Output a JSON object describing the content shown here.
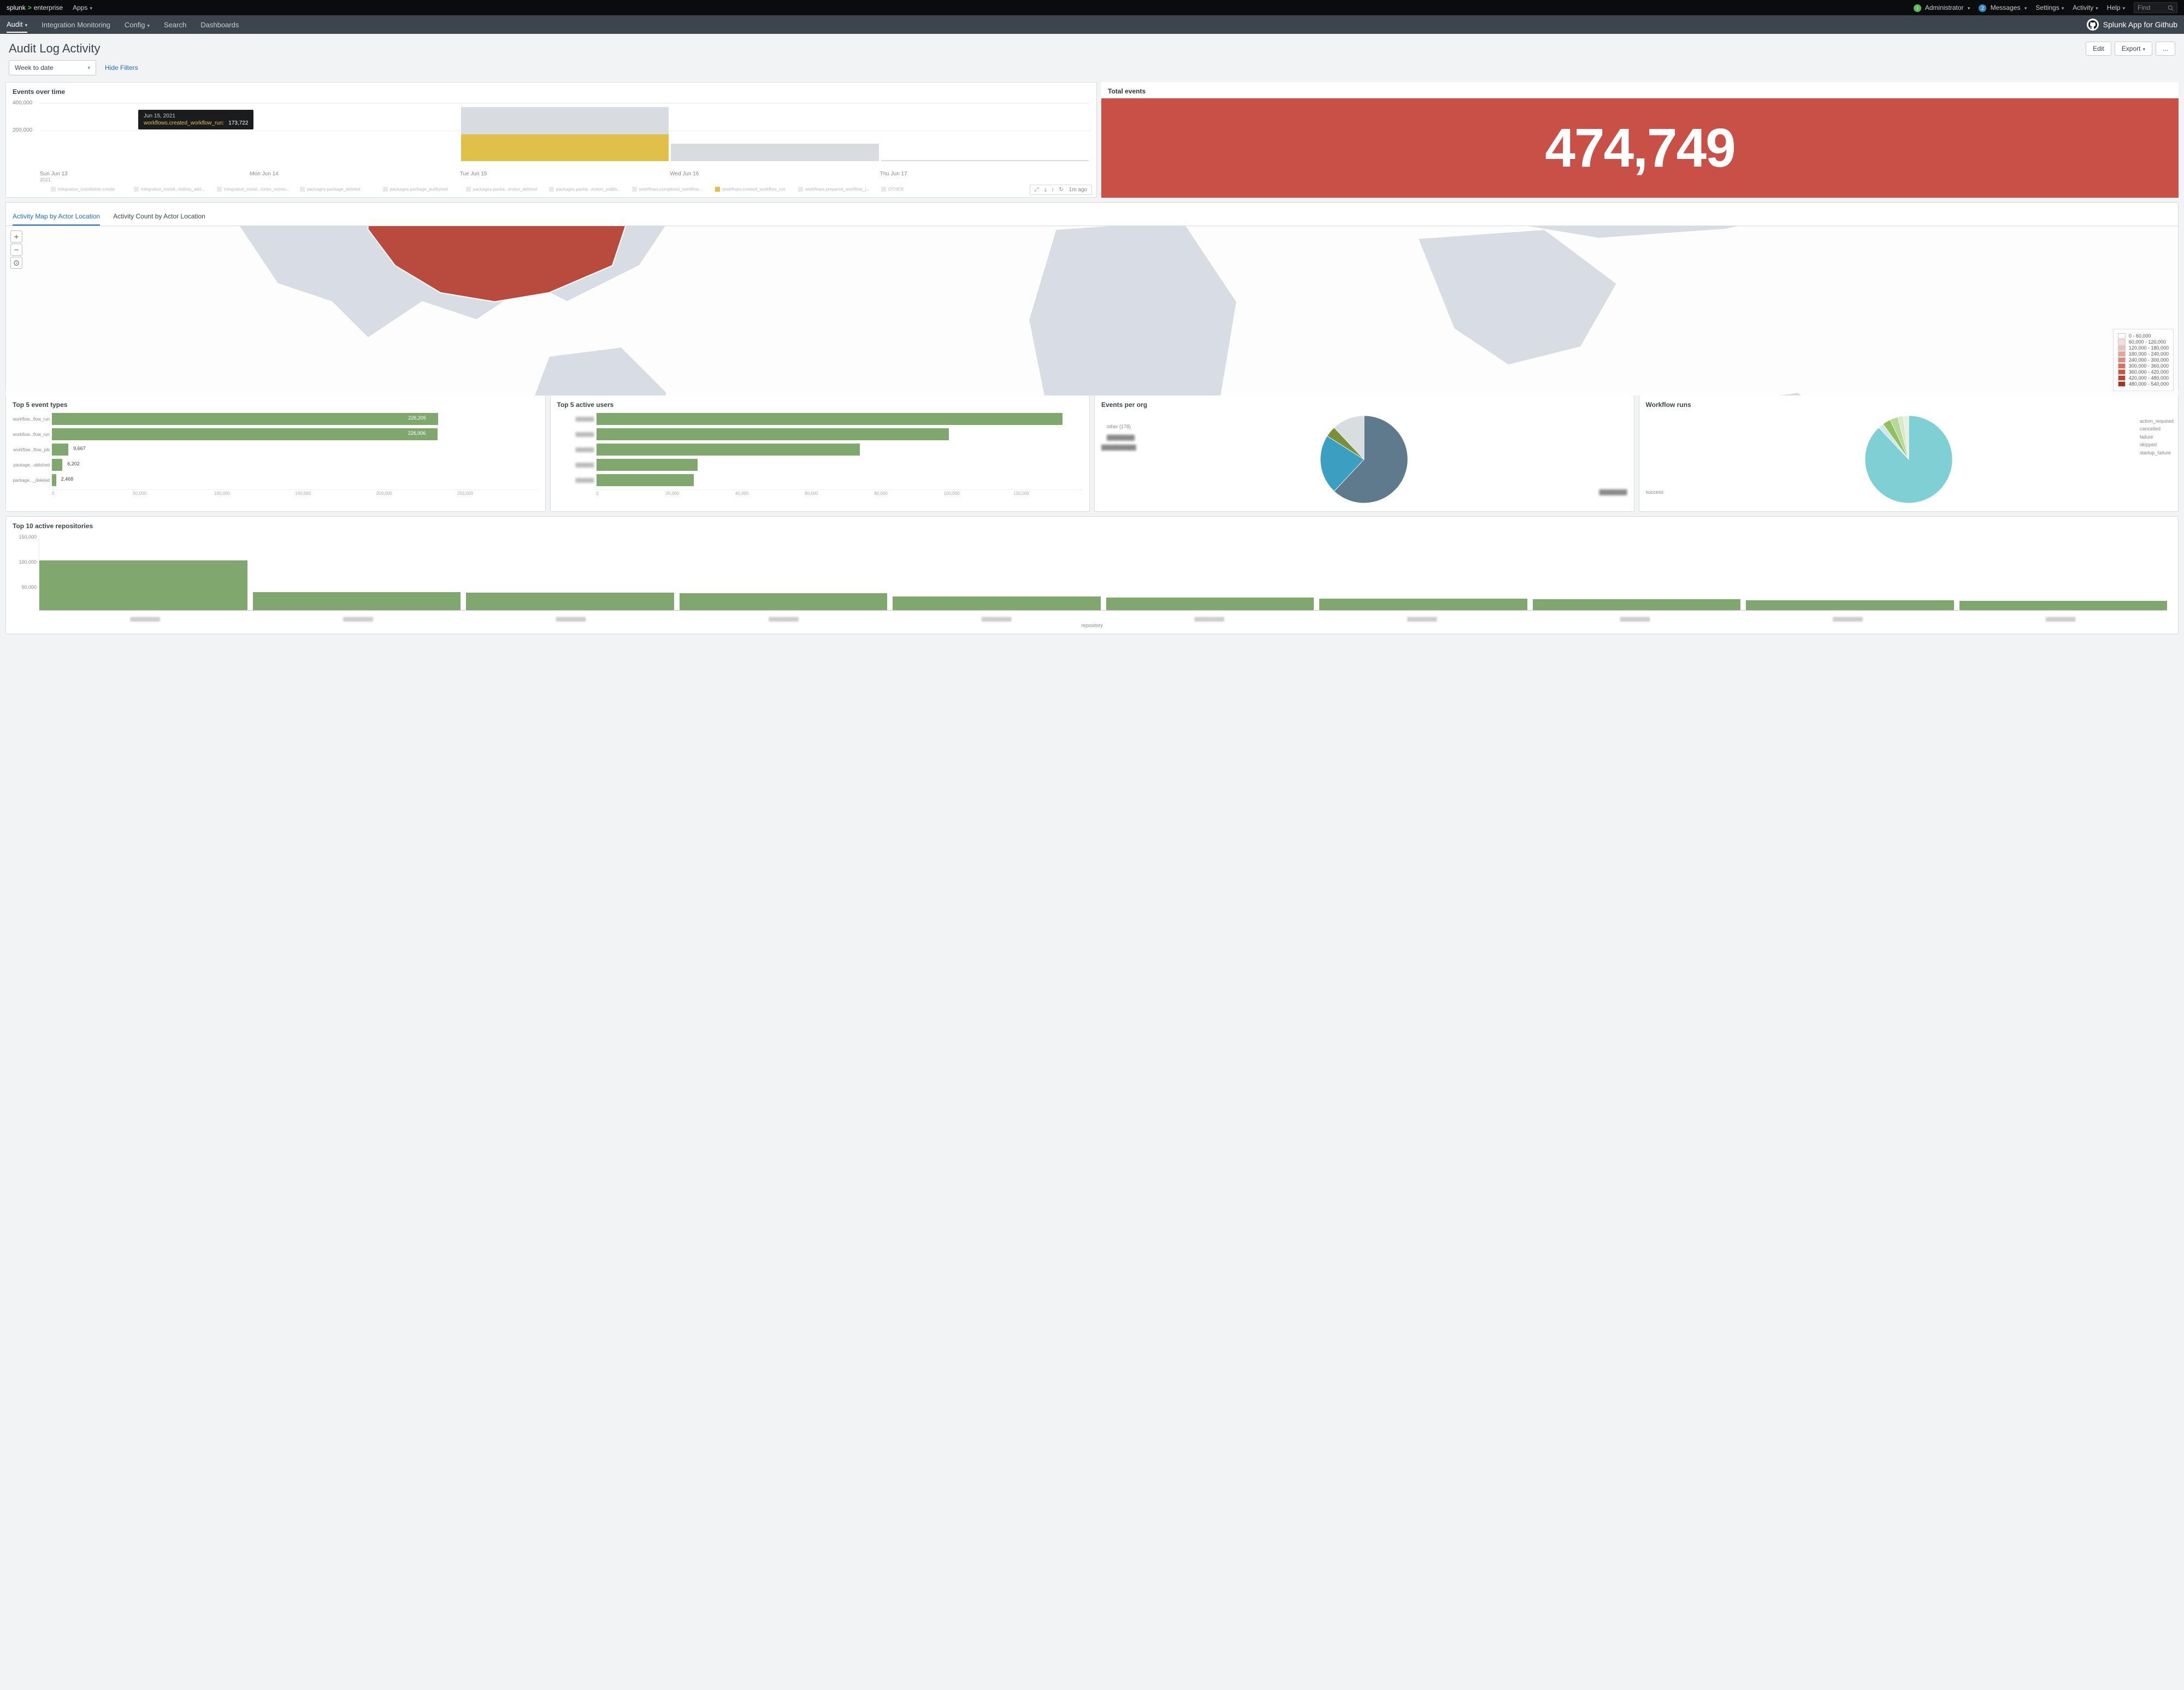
{
  "topbar": {
    "brand_sp": "splunk",
    "brand_ent": "enterprise",
    "apps": "Apps",
    "admin": "Administrator",
    "messages": "Messages",
    "messages_count": "2",
    "settings": "Settings",
    "activity": "Activity",
    "help": "Help",
    "find": "Find"
  },
  "appnav": {
    "items": [
      "Audit",
      "Integration Monitoring",
      "Config",
      "Search",
      "Dashboards"
    ],
    "appname": "Splunk App for Github"
  },
  "title": "Audit Log Activity",
  "btns": {
    "edit": "Edit",
    "export": "Export",
    "more": "..."
  },
  "filter": {
    "range": "Week to date",
    "hide": "Hide Filters"
  },
  "events_over_time": {
    "title": "Events over time",
    "yticks": [
      "400,000",
      "200,000"
    ],
    "xlabels": [
      "Sun Jun 13",
      "Mon Jun 14",
      "Tue Jun 15",
      "Wed Jun 16",
      "Thu Jun 17"
    ],
    "year": "2021",
    "tooltip": {
      "date": "Jun 15, 2021",
      "series": "workflows.created_workflow_run:",
      "value": "173,722"
    },
    "legend": [
      "integration_installation.create",
      "integration_install...tiotires_add...",
      "integration_instal...tories_remov...",
      "packages.package_deleted",
      "packages.package_published",
      "packages.packa...ersion_deleted",
      "packages.packa...ersion_publis...",
      "workflows.completed_workflow...",
      "workflows.created_workflow_run",
      "workflows.prepared_workflow_j...",
      "OTHER"
    ],
    "toolbar_time": "1m ago"
  },
  "total_events": {
    "title": "Total events",
    "value": "474,749"
  },
  "map_tabs": [
    "Activity Map by Actor Location",
    "Activity Count by Actor Location"
  ],
  "map_legend": [
    {
      "label": "0 - 60,000",
      "color": "#ffffff"
    },
    {
      "label": "60,000 - 120,000",
      "color": "#f5dcd8"
    },
    {
      "label": "120,000 - 180,000",
      "color": "#eec0b9"
    },
    {
      "label": "180,000 - 240,000",
      "color": "#e5a59b"
    },
    {
      "label": "240,000 - 300,000",
      "color": "#dc8a7d"
    },
    {
      "label": "300,000 - 360,000",
      "color": "#d3705f"
    },
    {
      "label": "360,000 - 420,000",
      "color": "#ca5642"
    },
    {
      "label": "420,000 - 480,000",
      "color": "#b94532"
    },
    {
      "label": "480,000 - 540,000",
      "color": "#a03526"
    }
  ],
  "top5_event_types": {
    "title": "Top 5 event types",
    "rows": [
      {
        "label": "workflow...flow_run",
        "value": 226205,
        "text": "226,205"
      },
      {
        "label": "workflow...flow_run",
        "value": 226006,
        "text": "226,006"
      },
      {
        "label": "workflow...flow_job",
        "value": 9667,
        "text": "9,667"
      },
      {
        "label": "package...ublished",
        "value": 6202,
        "text": "6,202"
      },
      {
        "label": "package..._deleted",
        "value": 2468,
        "text": "2,468"
      }
    ],
    "axis": [
      "0",
      "50,000",
      "100,000",
      "150,000",
      "200,000",
      "250,000"
    ],
    "max": 285000
  },
  "top5_active_users": {
    "title": "Top 5 active users",
    "rows": [
      {
        "value": 115000
      },
      {
        "value": 87000
      },
      {
        "value": 65000
      },
      {
        "value": 25000
      },
      {
        "value": 24000
      }
    ],
    "axis": [
      "0",
      "20,000",
      "40,000",
      "60,000",
      "80,000",
      "100,000",
      "120,000"
    ],
    "max": 120000
  },
  "events_per_org": {
    "title": "Events per org",
    "other_label": "other (178)"
  },
  "workflow_runs": {
    "title": "Workflow runs",
    "labels": [
      "action_required",
      "cancelled",
      "failure",
      "skipped",
      "startup_failure"
    ],
    "success": "success"
  },
  "top10_repos": {
    "title": "Top 10 active repositories",
    "yticks": [
      "150,000",
      "100,000",
      "50,000"
    ],
    "values": [
      98000,
      36000,
      35000,
      34000,
      27000,
      25000,
      23000,
      22000,
      19000,
      18000
    ],
    "max": 150000,
    "xtitle": "repository"
  },
  "chart_data": [
    {
      "type": "bar",
      "title": "Events over time",
      "stacked": true,
      "categories": [
        "Sun Jun 13 2021",
        "Mon Jun 14 2021",
        "Tue Jun 15 2021",
        "Wed Jun 16 2021",
        "Thu Jun 17 2021"
      ],
      "ylim": [
        0,
        400000
      ],
      "tooltip_point": {
        "date": "Jun 15, 2021",
        "series": "workflows.created_workflow_run",
        "value": 173722
      },
      "series_names": [
        "integration_installation.create",
        "integration_install repositories added",
        "integration_install repositories removed",
        "packages.package_deleted",
        "packages.package_published",
        "packages.package_version_deleted",
        "packages.package_version_published",
        "workflows.completed_workflow_run",
        "workflows.created_workflow_run",
        "workflows.prepared_workflow_job",
        "OTHER"
      ],
      "approx_totals": [
        0,
        0,
        350000,
        115000,
        8000
      ]
    },
    {
      "type": "single-value",
      "title": "Total events",
      "value": 474749
    },
    {
      "type": "choropleth",
      "title": "Activity Map by Actor Location",
      "bins": [
        [
          0,
          60000
        ],
        [
          60000,
          120000
        ],
        [
          120000,
          180000
        ],
        [
          180000,
          240000
        ],
        [
          240000,
          300000
        ],
        [
          300000,
          360000
        ],
        [
          360000,
          420000
        ],
        [
          420000,
          480000
        ],
        [
          480000,
          540000
        ]
      ],
      "highlighted": [
        {
          "region": "United States",
          "approx_bin": "420,000 - 480,000"
        }
      ]
    },
    {
      "type": "bar",
      "orientation": "horizontal",
      "title": "Top 5 event types",
      "categories": [
        "workflows...flow_run",
        "workflows...flow_run",
        "workflows...flow_job",
        "packages...published",
        "packages...deleted"
      ],
      "values": [
        226205,
        226006,
        9667,
        6202,
        2468
      ],
      "xlim": [
        0,
        250000
      ]
    },
    {
      "type": "bar",
      "orientation": "horizontal",
      "title": "Top 5 active users",
      "categories_redacted": true,
      "values": [
        115000,
        87000,
        65000,
        25000,
        24000
      ],
      "xlim": [
        0,
        120000
      ]
    },
    {
      "type": "pie",
      "title": "Events per org",
      "slices": [
        {
          "name": "org A",
          "pct": 62,
          "color": "#5f7a8c"
        },
        {
          "name": "org B",
          "pct": 22,
          "color": "#3b9fc2"
        },
        {
          "name": "org C",
          "pct": 4,
          "color": "#7a8f3a"
        },
        {
          "name": "other (178)",
          "pct": 12,
          "color": "#d8dde0"
        }
      ]
    },
    {
      "type": "pie",
      "title": "Workflow runs",
      "slices": [
        {
          "name": "success",
          "pct": 88,
          "color": "#7fd0d4"
        },
        {
          "name": "failure",
          "pct": 2,
          "color": "#cfe8ea"
        },
        {
          "name": "action_required",
          "pct": 3,
          "color": "#8fbf5f"
        },
        {
          "name": "cancelled",
          "pct": 3,
          "color": "#b8d89a"
        },
        {
          "name": "skipped",
          "pct": 2,
          "color": "#d8e8c8"
        },
        {
          "name": "startup_failure",
          "pct": 2,
          "color": "#e8f0dc"
        }
      ]
    },
    {
      "type": "bar",
      "title": "Top 10 active repositories",
      "categories_redacted": true,
      "values": [
        98000,
        36000,
        35000,
        34000,
        27000,
        25000,
        23000,
        22000,
        19000,
        18000
      ],
      "ylim": [
        0,
        150000
      ],
      "xlabel": "repository"
    }
  ]
}
